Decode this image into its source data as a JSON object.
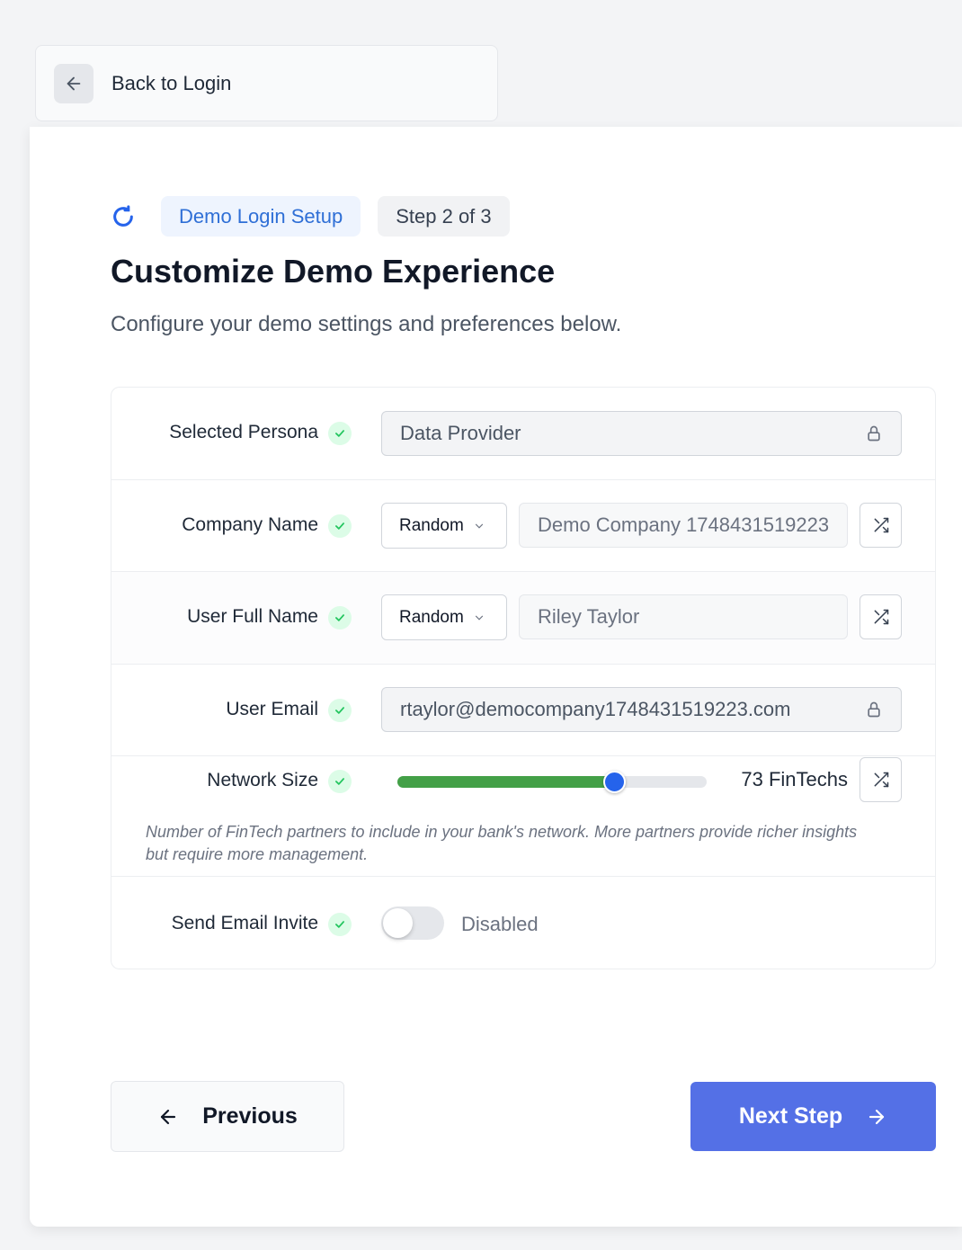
{
  "back": {
    "label": "Back to Login"
  },
  "header": {
    "badge": "Demo Login Setup",
    "step": "Step 2 of 3",
    "title": "Customize Demo Experience",
    "subtitle": "Configure your demo settings and preferences below."
  },
  "form": {
    "persona": {
      "label": "Selected Persona",
      "value": "Data Provider"
    },
    "company": {
      "label": "Company Name",
      "mode": "Random",
      "value": "Demo Company 1748431519223"
    },
    "fullname": {
      "label": "User Full Name",
      "mode": "Random",
      "value": "Riley Taylor"
    },
    "email": {
      "label": "User Email",
      "value": "rtaylor@democompany1748431519223.com"
    },
    "network": {
      "label": "Network Size",
      "value_text": "73 FinTechs",
      "level": 0.7,
      "hint": "Number of FinTech partners to include in your bank's network. More partners provide richer insights but require more management."
    },
    "invite": {
      "label": "Send Email Invite",
      "state": "Disabled",
      "enabled": false
    }
  },
  "nav": {
    "previous": "Previous",
    "next": "Next Step"
  },
  "colors": {
    "accent": "#5470e6",
    "slider_fill": "#43a047",
    "slider_thumb": "#2563eb",
    "check": "#22c55e"
  },
  "icons": [
    "arrow-left-icon",
    "refresh-icon",
    "check-icon",
    "lock-icon",
    "chevron-down-icon",
    "shuffle-icon",
    "arrow-right-icon"
  ]
}
